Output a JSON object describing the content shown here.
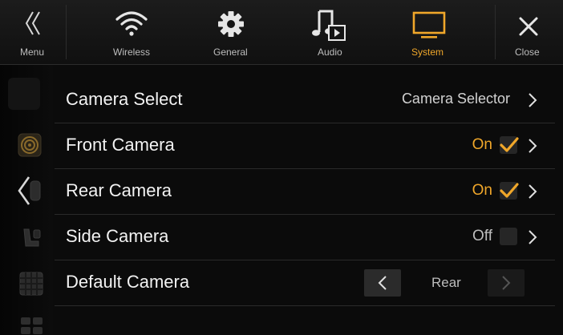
{
  "topbar": {
    "items": [
      {
        "label": "Menu",
        "icon": "double-chevron-left-icon"
      },
      {
        "label": "Wireless",
        "icon": "wifi-icon"
      },
      {
        "label": "General",
        "icon": "gear-icon"
      },
      {
        "label": "Audio",
        "icon": "music-note-icon"
      },
      {
        "label": "System",
        "icon": "monitor-icon",
        "active": true
      },
      {
        "label": "Close",
        "icon": "close-icon"
      }
    ]
  },
  "colors": {
    "accent": "#f0a72a",
    "background": "#0b0b0b",
    "text": "#f2f2f2"
  },
  "settings": {
    "camera_select": {
      "label": "Camera Select",
      "value": "Camera Selector"
    },
    "front_camera": {
      "label": "Front Camera",
      "value": "On",
      "checked": true
    },
    "rear_camera": {
      "label": "Rear Camera",
      "value": "On",
      "checked": true
    },
    "side_camera": {
      "label": "Side Camera",
      "value": "Off",
      "checked": false
    },
    "default_camera": {
      "label": "Default Camera",
      "value": "Rear"
    }
  },
  "rail": {
    "icons": [
      "blank-tile-icon",
      "speaker-icon",
      "back-arrow-icon",
      "car-seat-icon",
      "grid-panel-icon",
      "tiles-icon"
    ]
  }
}
